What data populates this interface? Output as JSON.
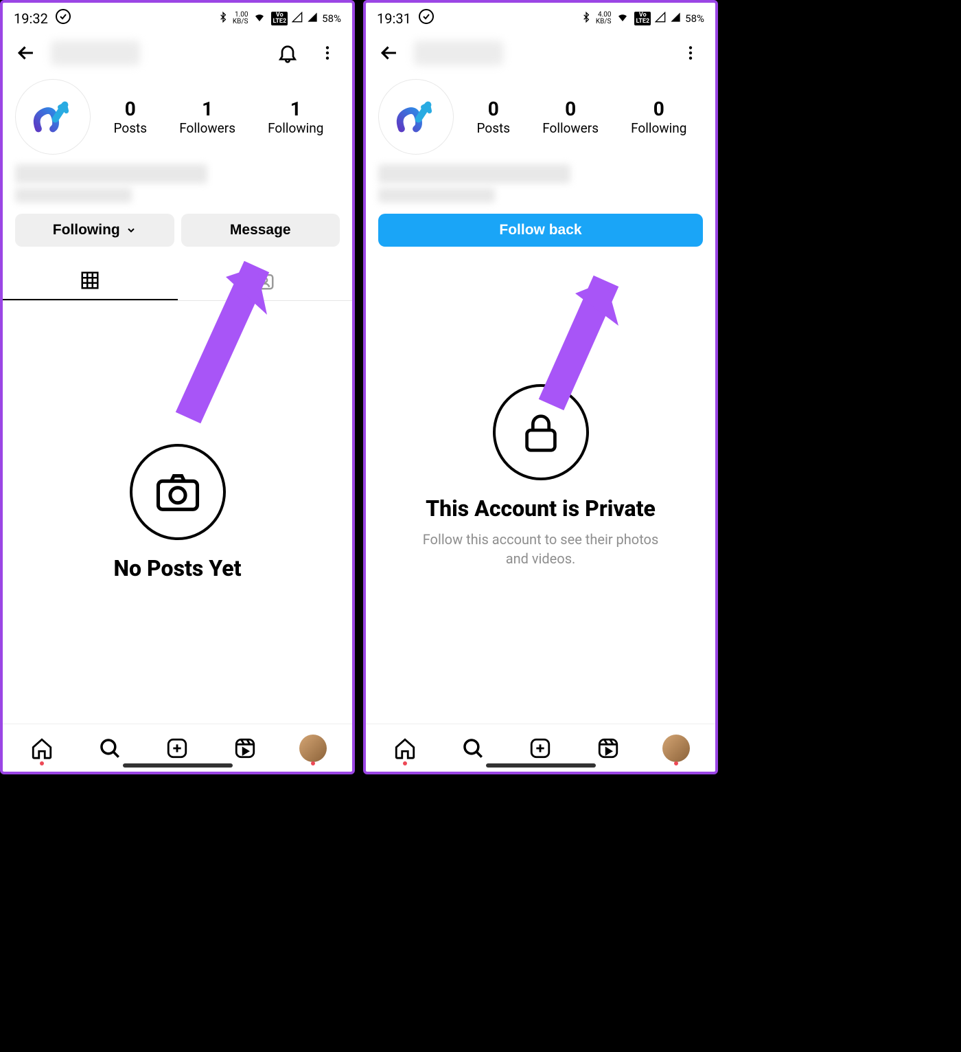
{
  "left": {
    "status": {
      "time": "19:32",
      "speed_num": "1.00",
      "speed_unit": "KB/S",
      "battery": "58%"
    },
    "stats": {
      "posts_num": "0",
      "posts_lbl": "Posts",
      "followers_num": "1",
      "followers_lbl": "Followers",
      "following_num": "1",
      "following_lbl": "Following"
    },
    "actions": {
      "following": "Following",
      "message": "Message"
    },
    "empty": {
      "title": "No Posts Yet"
    }
  },
  "right": {
    "status": {
      "time": "19:31",
      "speed_num": "4.00",
      "speed_unit": "KB/S",
      "battery": "58%"
    },
    "stats": {
      "posts_num": "0",
      "posts_lbl": "Posts",
      "followers_num": "0",
      "followers_lbl": "Followers",
      "following_num": "0",
      "following_lbl": "Following"
    },
    "actions": {
      "follow_back": "Follow back"
    },
    "private": {
      "title": "This Account is Private",
      "sub": "Follow this account to see their photos and videos."
    }
  }
}
